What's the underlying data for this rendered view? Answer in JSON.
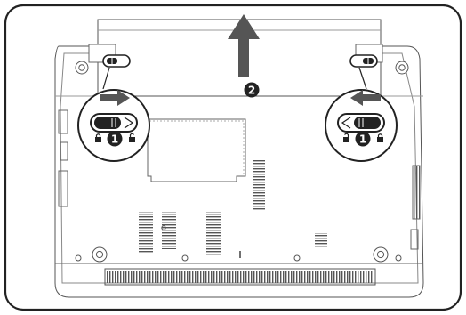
{
  "steps": {
    "slide_latches": "1",
    "remove_battery": "2"
  },
  "colors": {
    "frame": "#222222",
    "line": "#444444",
    "light_fill": "#f2f2f2",
    "arrow": "#555555",
    "badge": "#222222"
  }
}
